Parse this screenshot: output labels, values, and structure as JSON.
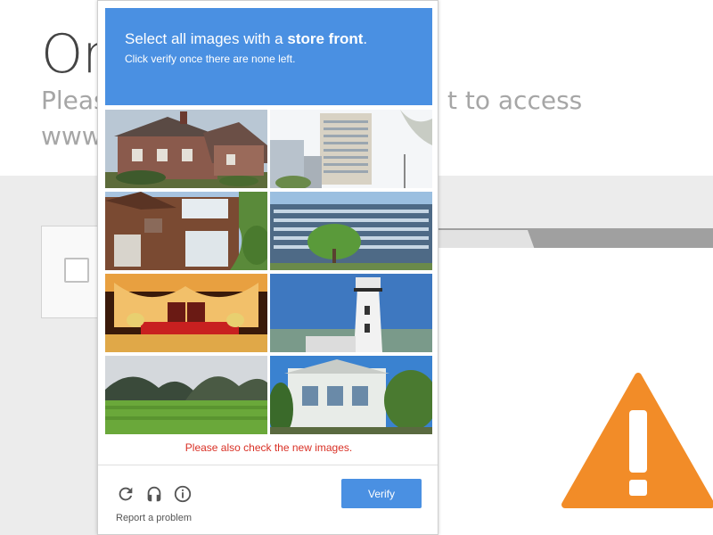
{
  "background_page": {
    "title": "Or",
    "subtitle_left": "Pleas",
    "subtitle_right": "t to access",
    "url_fragment": "www"
  },
  "captcha": {
    "header": {
      "prompt_prefix": "Select all images with a ",
      "prompt_target": "store front",
      "prompt_suffix": ".",
      "instruction": "Click verify once there are none left."
    },
    "tiles": [
      {
        "subject": "brick cottage"
      },
      {
        "subject": "tall hotel building"
      },
      {
        "subject": "brick house with windows"
      },
      {
        "subject": "office building with tree"
      },
      {
        "subject": "stage with red curtains"
      },
      {
        "subject": "lighthouse"
      },
      {
        "subject": "green field and hills"
      },
      {
        "subject": "white house with trees"
      }
    ],
    "new_images_message": "Please also check the new images.",
    "footer": {
      "verify_label": "Verify",
      "report_label": "Report a problem",
      "icons": [
        "reload-icon",
        "audio-icon",
        "info-icon"
      ]
    }
  },
  "colors": {
    "accent": "#4a90e2",
    "error": "#d93025",
    "warning": "#f28c28"
  }
}
